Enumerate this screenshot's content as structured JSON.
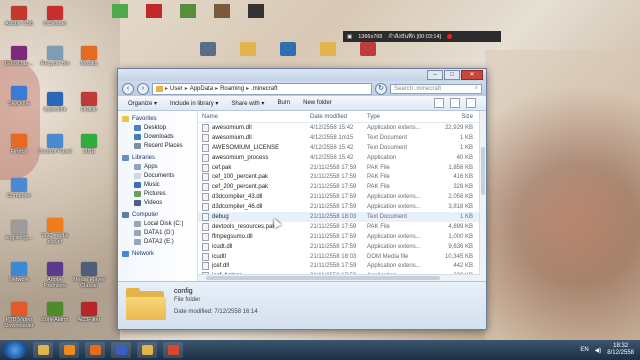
{
  "desktop": {
    "icons": [
      {
        "label": "Adobe CS6",
        "color": "#c6372c"
      },
      {
        "label": "GhostTab...",
        "color": "#7d2a7d"
      },
      {
        "label": "SkyDrive",
        "color": "#3b7bd8"
      },
      {
        "label": "Firefox",
        "color": "#e66b1e"
      },
      {
        "label": "Computer",
        "color": "#4a8ad1"
      },
      {
        "label": "english@...",
        "color": "#9c9c9c"
      },
      {
        "label": "Network",
        "color": "#3b8ad8"
      },
      {
        "label": "PTB Video Downloader",
        "color": "#e35a2b"
      },
      {
        "label": "CCleaner",
        "color": "#c92f2f"
      },
      {
        "label": "Recycle Bin",
        "color": "#7f9bb6"
      },
      {
        "label": "Cyberlink",
        "color": "#2c68b8"
      },
      {
        "label": "Control Panel",
        "color": "#4a8ad1"
      },
      {
        "label": "VLC media player",
        "color": "#f07c1a"
      },
      {
        "label": "Adobe Premiere",
        "color": "#5d3a8c"
      },
      {
        "label": "Media Player Classic",
        "color": "#4f5f7a"
      },
      {
        "label": "AC3Filter",
        "color": "#b7262b"
      },
      {
        "label": "LINE",
        "color": "#2fae3b"
      },
      {
        "label": "Oracle",
        "color": "#c13a3a"
      },
      {
        "label": "Mozilla",
        "color": "#e66b1e"
      },
      {
        "label": "ZoneAlarm",
        "color": "#4f8a2c"
      }
    ]
  },
  "recorder": {
    "resolution": "1366x768",
    "status": "กำลังบันทึก [00:03:14]"
  },
  "window": {
    "controls": {
      "minimize": "–",
      "maximize": "□",
      "close": "✕"
    },
    "address": {
      "segments": [
        "User",
        "AppData",
        "Roaming",
        ".minecraft"
      ],
      "separator": "▸"
    },
    "search": {
      "placeholder": "Search .minecraft",
      "icon": "search-icon"
    },
    "toolbar": {
      "organize": "Organize ▾",
      "include": "Include in library ▾",
      "share": "Share with ▾",
      "burn": "Burn",
      "new_folder": "New folder"
    },
    "nav": {
      "favorites": {
        "title": "Favorites",
        "items": [
          "Desktop",
          "Downloads",
          "Recent Places"
        ]
      },
      "libraries": {
        "title": "Libraries",
        "items": [
          "Apps",
          "Documents",
          "Music",
          "Pictures",
          "Videos"
        ]
      },
      "computer": {
        "title": "Computer",
        "items": [
          "Local Disk (C:)",
          "DATA1 (D:)",
          "DATA2 (E:)"
        ]
      },
      "network": {
        "title": "Network"
      }
    },
    "columns": {
      "name": "Name",
      "date": "Date modified",
      "type": "Type",
      "size": "Size"
    },
    "files": [
      {
        "name": "awesomium.dll",
        "date": "4/12/2558 15:42",
        "type": "Application extens...",
        "size": "22,929 KB"
      },
      {
        "name": "awesomium.dll",
        "date": "4/12/2558 1m15",
        "type": "Text Document",
        "size": "1 KB"
      },
      {
        "name": "AWESOMIUM_LICENSE",
        "date": "4/12/2558 15:42",
        "type": "Text Document",
        "size": "1 KB"
      },
      {
        "name": "awesomium_process",
        "date": "4/12/2558 15:42",
        "type": "Application",
        "size": "40 KB"
      },
      {
        "name": "cef.pak",
        "date": "21/11/2558 17:59",
        "type": "PAK File",
        "size": "1,858 KB"
      },
      {
        "name": "cef_100_percent.pak",
        "date": "21/11/2558 17:59",
        "type": "PAK File",
        "size": "416 KB"
      },
      {
        "name": "cef_200_percent.pak",
        "date": "21/11/2558 17:59",
        "type": "PAK File",
        "size": "328 KB"
      },
      {
        "name": "d3dcompiler_43.dll",
        "date": "21/11/2558 17:59",
        "type": "Application extens...",
        "size": "2,058 KB"
      },
      {
        "name": "d3dcompiler_46.dll",
        "date": "21/11/2558 17:59",
        "type": "Application extens...",
        "size": "3,818 KB"
      },
      {
        "name": "debug",
        "date": "21/11/2558 18:03",
        "type": "Text Document",
        "size": "1 KB"
      },
      {
        "name": "devtools_resources.pak",
        "date": "21/11/2558 17:59",
        "type": "PAK File",
        "size": "4,899 KB"
      },
      {
        "name": "ffmpegsumo.dll",
        "date": "21/11/2558 17:59",
        "type": "Application extens...",
        "size": "1,000 KB"
      },
      {
        "name": "icudt.dll",
        "date": "21/11/2558 17:59",
        "type": "Application extens...",
        "size": "9,636 KB"
      },
      {
        "name": "icudtl",
        "date": "21/11/2558 18:03",
        "type": "DOM Media file",
        "size": "10,345 KB"
      },
      {
        "name": "jcef.dll",
        "date": "21/11/2558 17:59",
        "type": "Application extens...",
        "size": "442 KB"
      },
      {
        "name": "jcef_helper",
        "date": "21/11/2558 17:59",
        "type": "Application",
        "size": "220 KB"
      }
    ],
    "details": {
      "name": "config",
      "type": "File folder",
      "modified": "Date modified: 7/12/2558 16:14"
    }
  },
  "taskbar": {
    "apps": [
      {
        "name": "explorer",
        "color": "#e3b44b"
      },
      {
        "name": "media-player",
        "color": "#f08a1a"
      },
      {
        "name": "firefox",
        "color": "#e66b1e"
      },
      {
        "name": "bandicam",
        "color": "#3a5fc4"
      },
      {
        "name": "folder",
        "color": "#e3b44b"
      },
      {
        "name": "chrome",
        "color": "#d9482b"
      }
    ],
    "language": "EN",
    "time": "18:32",
    "date": "8/12/2558"
  }
}
